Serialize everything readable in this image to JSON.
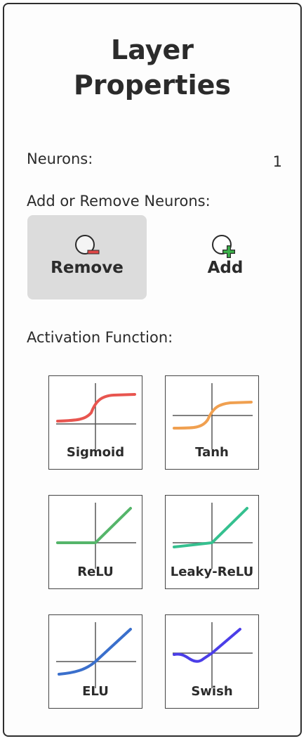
{
  "panel": {
    "title_line1": "Layer",
    "title_line2": "Properties",
    "neurons_label": "Neurons:",
    "neurons_value": "1",
    "add_remove_label": "Add or Remove Neurons:",
    "remove_label": "Remove",
    "add_label": "Add",
    "activation_label": "Activation Function:"
  },
  "activations": [
    {
      "label": "Sigmoid",
      "color": "#e8554f",
      "icon": "sigmoid-curve-icon"
    },
    {
      "label": "Tanh",
      "color": "#f0a050",
      "icon": "tanh-curve-icon"
    },
    {
      "label": "ReLU",
      "color": "#55b56a",
      "icon": "relu-curve-icon"
    },
    {
      "label": "Leaky-ReLU",
      "color": "#35c08f",
      "icon": "leaky-relu-curve-icon"
    },
    {
      "label": "ELU",
      "color": "#3a6fcc",
      "icon": "elu-curve-icon"
    },
    {
      "label": "Swish",
      "color": "#4b3ee8",
      "icon": "swish-curve-icon"
    }
  ],
  "colors": {
    "remove_badge": "#e04848",
    "add_badge": "#3cb44b",
    "selected_bg": "#dcdcdc"
  }
}
